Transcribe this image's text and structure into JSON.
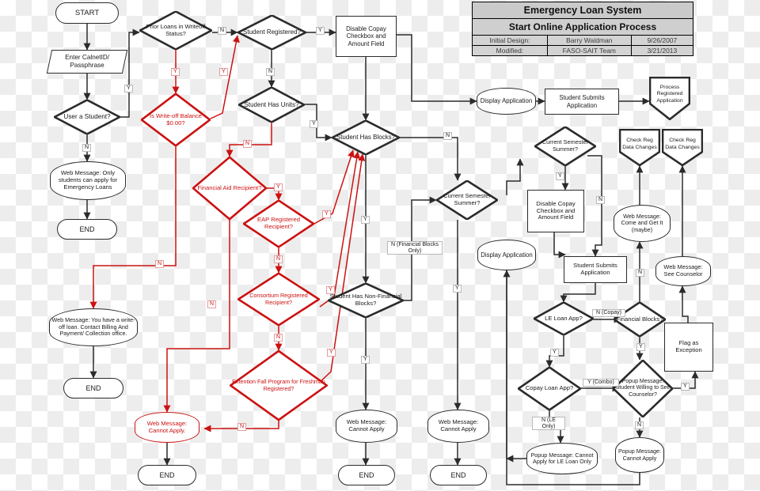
{
  "title_block": {
    "system": "Emergency Loan System",
    "process": "Start Online Application Process",
    "rows": [
      {
        "label": "Initial Design:",
        "value": "Barry Waldman",
        "date": "9/26/2007"
      },
      {
        "label": "Modified:",
        "value": "FASO-SAIT Team",
        "date": "3/21/2013"
      }
    ]
  },
  "colors": {
    "black_path": "#2b2b2b",
    "red_path": "#cc1111",
    "node_fill": "#ffffff",
    "title_fill": "#cfcfcf"
  },
  "nodes": {
    "start": "START",
    "enter_calnet": "Enter CalnetID/ Passphrase",
    "user_student": "User a Student?",
    "web_only_students": "Web Message: Only students can apply for Emergency Loans",
    "end_1": "END",
    "prior_loans": "Prior Loans in Writeoff Status?",
    "is_writeoff_zero": "Is Write-off Balance $0.00?",
    "web_writeoff": "Web Message: You have a write-off loan. Contact Billing And Payment/ Collection office.",
    "end_2": "END",
    "student_registered": "Student Registered?",
    "student_has_units": "Student Has Units?",
    "financial_aid_recipient": "Financial Aid Recipient?",
    "eap_registered": "EAP Registered Recipient?",
    "consortium_registered": "Consortium Registered Recipient?",
    "extention_fall": "Extention Fall Program for Freshman Registered?",
    "web_cannot_apply_red": "Web Message: Cannot Apply.",
    "end_3": "END",
    "disable_copay_1": "Disable Copay Checkbox and Amount Field",
    "student_has_blocks": "Student Has Blocks?",
    "student_has_nonfin_blocks": "Student Has Non-Financial Blocks?",
    "web_cannot_apply_1": "Web Message: Cannot Apply",
    "end_4": "END",
    "current_sem_summer_1": "Current Semester Summer?",
    "web_cannot_apply_2": "Web Message: Cannot Apply",
    "end_5": "END",
    "display_application_1": "Display Application",
    "student_submits_1": "Student Submits Application",
    "process_registered": "Process Registered Application",
    "current_sem_summer_2": "Current Semester Summer?",
    "disable_copay_2": "Disable Copay Checkbox and Amount Field",
    "display_application_2": "Display Application",
    "student_submits_2": "Student Submits Application",
    "le_loan_app": "LE Loan App?",
    "copay_loan_app": "Copay Loan App?",
    "financial_blocks": "Financial Blocks?",
    "popup_student_willing": "Popup Message: Student Willing to See Counselor?",
    "popup_cannot_le": "Popup Message: Cannot Apply for LE Loan Only",
    "popup_cannot_apply": "Popup Message: Cannot Apply",
    "web_come_and_get_it": "Web Message: Come and Get It (maybe)",
    "web_see_counselor": "Web Message: See Counselor",
    "flag_as_exception": "Flag as Exception",
    "check_reg_1": "Check Reg Data Changes",
    "check_reg_2": "Check Reg Data Changes"
  },
  "edge_labels": {
    "user_student_y": "Y",
    "user_student_n": "N",
    "prior_loans_n": "N",
    "prior_loans_y": "Y",
    "writeoff_y": "Y",
    "writeoff_n": "N",
    "registered_y": "Y",
    "registered_n": "N",
    "units_y": "Y",
    "units_n": "N",
    "fin_aid_y": "Y",
    "fin_aid_n": "N",
    "eap_y": "Y",
    "eap_n": "N",
    "consortium_y": "Y",
    "consortium_n": "N",
    "extention_y": "Y",
    "extention_n": "N",
    "blocks_y": "Y",
    "blocks_n": "N",
    "nonfin_y": "Y",
    "nonfin_n": "N (Financial Blocks Only)",
    "summer1_y": "Y",
    "summer2_y": "Y",
    "summer2_n": "N",
    "le_loan_y": "Y",
    "le_loan_n": "N (Copay)",
    "copay_loan_y": "Y (Combo)",
    "copay_loan_n": "N (LE Only)",
    "fin_blocks_y": "Y",
    "fin_blocks_n": "N",
    "willing_y": "Y",
    "willing_n": "N"
  }
}
